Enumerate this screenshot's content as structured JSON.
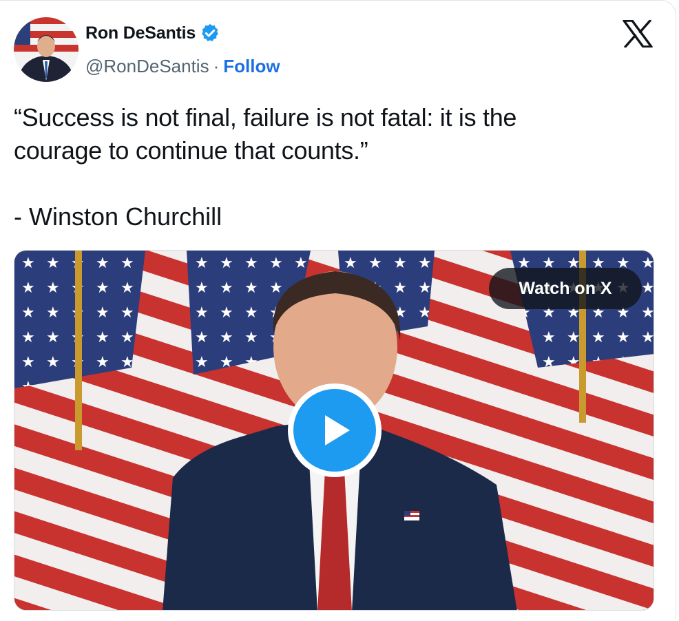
{
  "tweet": {
    "author_name": "Ron DeSantis",
    "handle": "@RonDeSantis",
    "separator": "·",
    "follow_label": "Follow",
    "text_line_1": "“Success is not final, failure is not fatal: it is the",
    "text_line_2": "courage to continue that counts.”",
    "attribution": "- Winston Churchill"
  },
  "media": {
    "watch_label": "Watch on X"
  },
  "icons": {
    "verified": "verified-badge-icon",
    "platform": "x-logo-icon",
    "play": "play-icon"
  },
  "colors": {
    "accent": "#1d9bf0",
    "follow": "#1d6fe0",
    "text": "#0f1419",
    "muted": "#536471"
  }
}
